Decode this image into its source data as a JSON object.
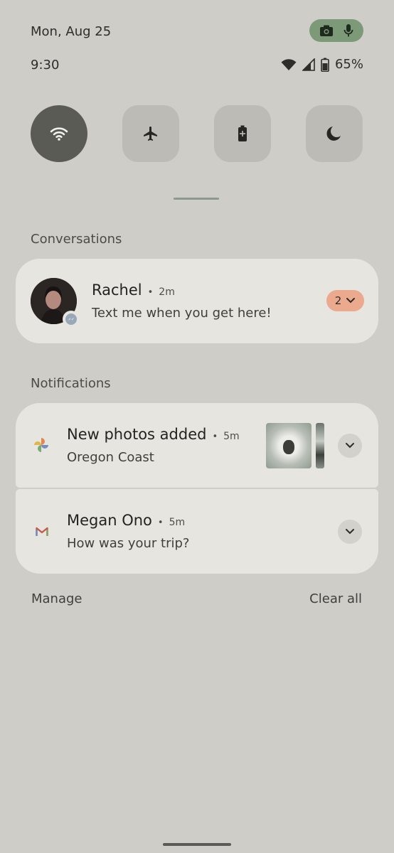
{
  "status_bar": {
    "date": "Mon, Aug 25",
    "time": "9:30",
    "battery_percent": "65%",
    "privacy_chip_color": "#7d9a78"
  },
  "quick_settings": {
    "tiles": [
      {
        "name": "wifi",
        "icon": "wifi-icon",
        "active": true
      },
      {
        "name": "airplane-mode",
        "icon": "airplane-icon",
        "active": false
      },
      {
        "name": "battery-saver",
        "icon": "battery-saver-icon",
        "active": false
      },
      {
        "name": "dark-theme",
        "icon": "moon-icon",
        "active": false
      }
    ]
  },
  "conversations": {
    "heading": "Conversations",
    "items": [
      {
        "name": "Rachel",
        "time_ago": "2m",
        "message": "Text me when you get here!",
        "count": "2",
        "app_icon": "messenger-icon"
      }
    ]
  },
  "notifications": {
    "heading": "Notifications",
    "items": [
      {
        "title": "New photos added",
        "time_ago": "5m",
        "text": "Oregon Coast",
        "app_icon": "photos-pinwheel-icon"
      },
      {
        "title": "Megan Ono",
        "time_ago": "5m",
        "text": "How was your trip?",
        "app_icon": "gmail-icon"
      }
    ]
  },
  "footer": {
    "manage_label": "Manage",
    "clear_all_label": "Clear all"
  },
  "colors": {
    "background": "#cfcdc8",
    "card": "#e7e5e0",
    "active_tile": "#595b54",
    "count_pill": "#eba98d"
  }
}
